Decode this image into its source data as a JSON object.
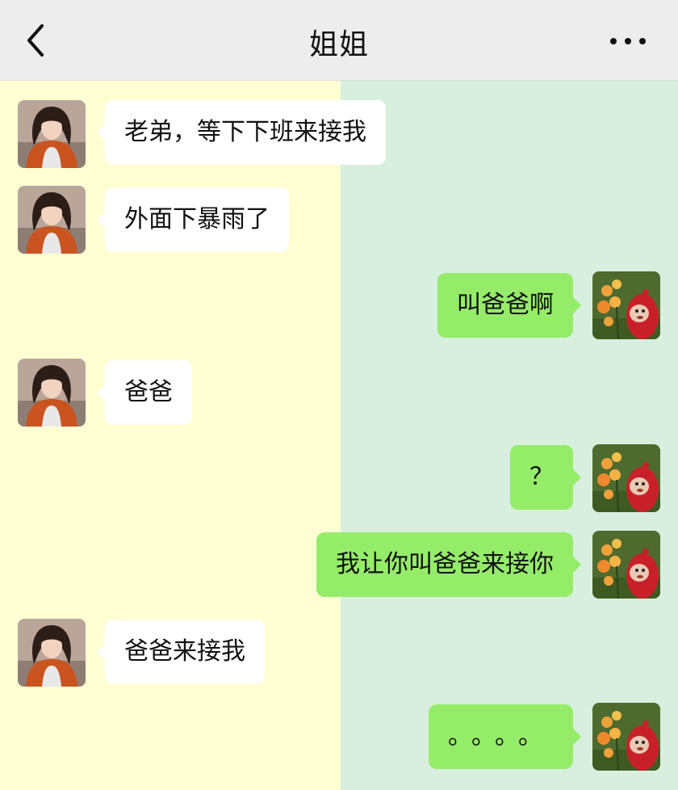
{
  "header": {
    "title": "姐姐",
    "back_icon": "chevron-left-icon",
    "more_icon": "more-dots-icon"
  },
  "colors": {
    "left_bg": "#fffed3",
    "right_bg": "#d8efdf",
    "incoming_bubble": "#ffffff",
    "outgoing_bubble": "#95ec69"
  },
  "messages": [
    {
      "from": "sister",
      "text": "老弟，等下下班来接我"
    },
    {
      "from": "sister",
      "text": "外面下暴雨了"
    },
    {
      "from": "me",
      "text": "叫爸爸啊"
    },
    {
      "from": "sister",
      "text": "爸爸"
    },
    {
      "from": "me",
      "text": "？"
    },
    {
      "from": "me",
      "text": "我让你叫爸爸来接你"
    },
    {
      "from": "sister",
      "text": "爸爸来接我"
    },
    {
      "from": "me",
      "text": "。。。。"
    }
  ]
}
